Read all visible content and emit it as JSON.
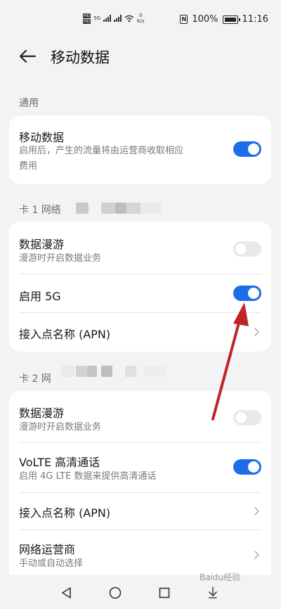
{
  "status_bar": {
    "sim1": "HD",
    "sim2": "HD",
    "net_type": "5G",
    "speed_value": "0",
    "speed_unit": "K/s",
    "battery": "100%",
    "time": "11:16"
  },
  "header": {
    "title": "移动数据"
  },
  "section_general": {
    "label": "通用"
  },
  "mobile_data": {
    "title": "移动数据",
    "subtitle_line1": "启用后，产生的流量将由运营商收取相应",
    "subtitle_line2": "费用",
    "enabled": true
  },
  "section_card1": {
    "label": "卡 1 网络"
  },
  "card1": {
    "roaming_title": "数据漫游",
    "roaming_subtitle": "漫游时开启数据业务",
    "roaming_enabled": false,
    "enable5g_title": "启用 5G",
    "enable5g_enabled": true,
    "apn_label": "接入点名称 (APN)"
  },
  "section_card2": {
    "label": "卡 2 网"
  },
  "card2": {
    "roaming_title": "数据漫游",
    "roaming_subtitle": "漫游时开启数据业务",
    "roaming_enabled": false,
    "volte_title": "VoLTE 高清通话",
    "volte_subtitle": "启用 4G LTE 数据来提供高清通话",
    "volte_enabled": true,
    "apn_label": "接入点名称 (APN)",
    "carrier_title": "网络运营商",
    "carrier_subtitle": "手动或自动选择"
  },
  "watermark": "Baidu经验",
  "colors": {
    "accent": "#1c6ee8",
    "annotation_arrow": "#c0242b",
    "background": "#f1f3f5"
  }
}
